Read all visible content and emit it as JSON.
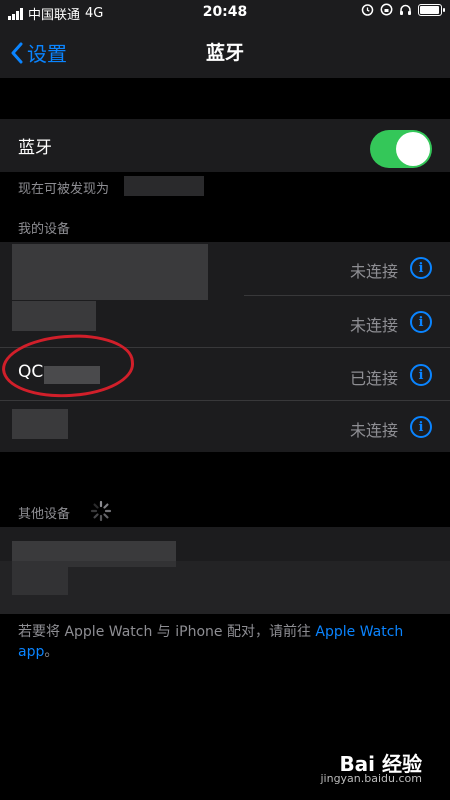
{
  "status_bar": {
    "carrier": "中国联通",
    "network": "4G",
    "time": "20:48",
    "battery_level": 0.95
  },
  "nav": {
    "back_label": "设置",
    "title": "蓝牙"
  },
  "bluetooth": {
    "label": "蓝牙",
    "enabled": true,
    "discoverable_text": "现在可被发现为"
  },
  "my_devices": {
    "header": "我的设备",
    "items": [
      {
        "name": "",
        "status": "未连接"
      },
      {
        "name": "",
        "status": "未连接"
      },
      {
        "name": "QC",
        "status": "已连接"
      },
      {
        "name": "",
        "status": "未连接"
      }
    ]
  },
  "other_devices": {
    "header": "其他设备"
  },
  "footer": {
    "text": "若要将 Apple Watch 与 iPhone 配对，请前往 ",
    "link": "Apple Watch app",
    "suffix": "。"
  },
  "watermark": {
    "brand": "Bai 经验",
    "url": "jingyan.baidu.com"
  },
  "colors": {
    "accent": "#0a84ff",
    "toggle_on": "#34c759",
    "annotation": "#d11f2a"
  }
}
